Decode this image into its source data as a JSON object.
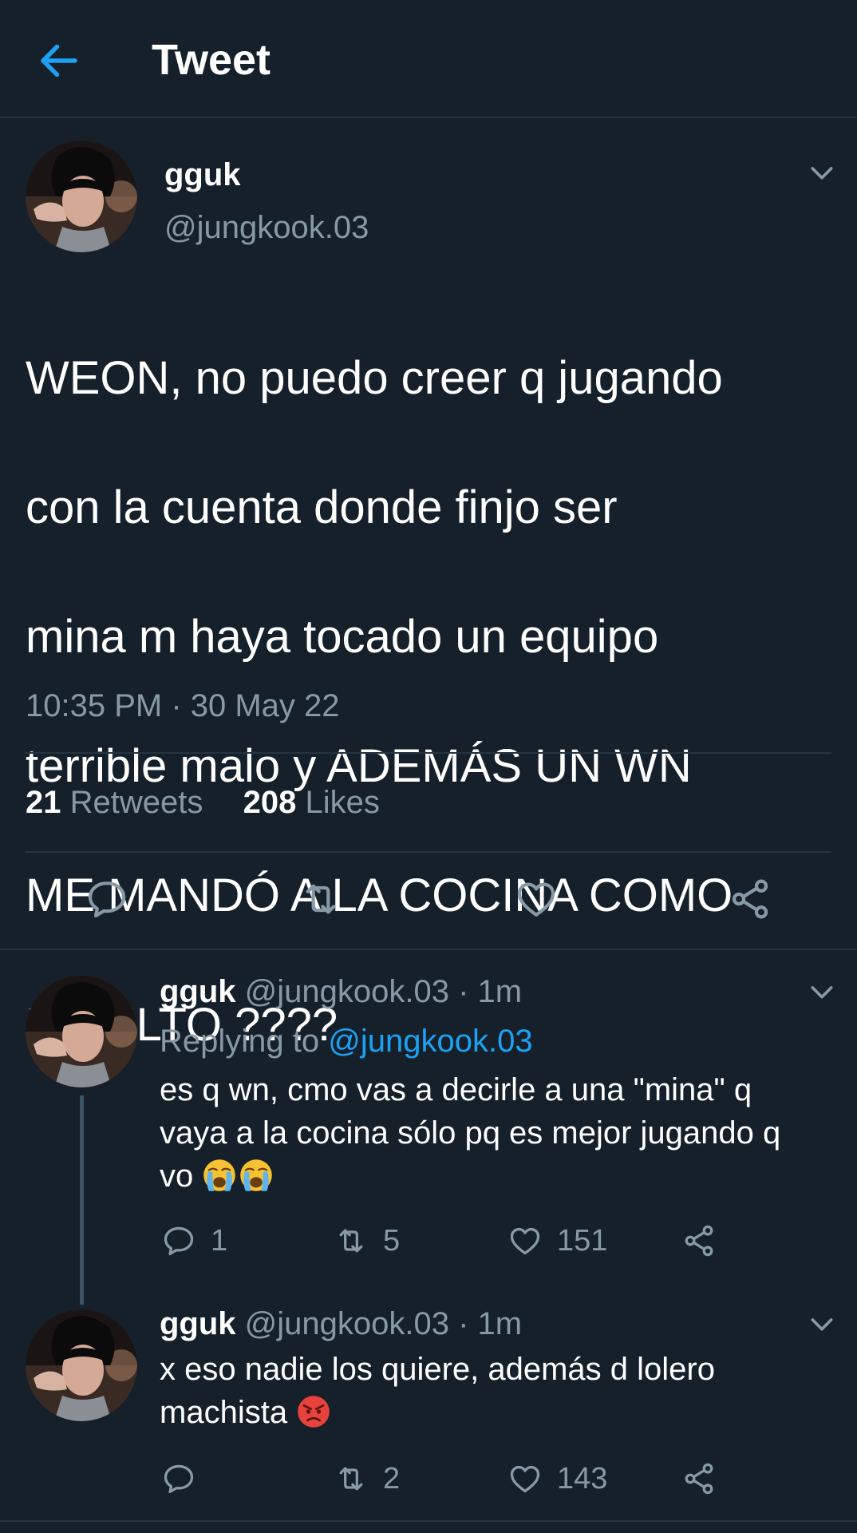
{
  "header": {
    "title": "Tweet",
    "back_icon": "arrow-left-icon",
    "accent": "#1da1f2"
  },
  "tweet": {
    "name": "gguk",
    "handle": "@jungkook.03",
    "lines": [
      "WEON, no puedo creer q jugando",
      "con la cuenta donde finjo ser",
      "mina m haya tocado un equipo",
      "terrible malo y ADEMÁS UN WN",
      "ME MANDÓ A LA COCINA COMO",
      "INSULTO ????"
    ],
    "timestamp": "10:35 PM · 30 May 22",
    "retweets_count": "21",
    "retweets_label": "Retweets",
    "likes_count": "208",
    "likes_label": "Likes"
  },
  "replies": [
    {
      "name": "gguk",
      "meta": "@jungkook.03 · 1m",
      "replying_prefix": "Replying to ",
      "replying_handle": "@jungkook.03",
      "line1": "es q wn, cmo vas a decirle a una \"mina\" q",
      "line2": "vaya a la cocina sólo pq es mejor jugando q",
      "line3": "vo",
      "emojis": [
        "loudly-crying-face-emoji",
        "loudly-crying-face-emoji"
      ],
      "reply_count": "1",
      "retweet_count": "5",
      "like_count": "151"
    },
    {
      "name": "gguk",
      "meta": "@jungkook.03 · 1m",
      "line1": "x eso nadie los quiere, además d lolero",
      "line2": "machista",
      "emojis": [
        "angry-face-emoji"
      ],
      "reply_count": "",
      "retweet_count": "2",
      "like_count": "143"
    }
  ],
  "colors": {
    "background": "#15202b",
    "muted": "#8899a6",
    "divider": "#253341",
    "link": "#1da1f2"
  }
}
